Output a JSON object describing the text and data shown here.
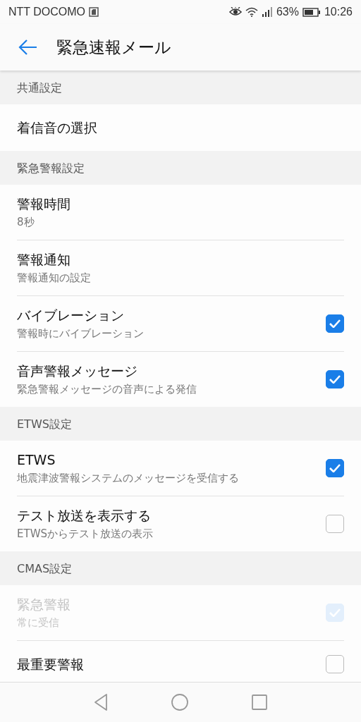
{
  "status_bar": {
    "carrier": "NTT DOCOMO",
    "battery_percent": "63%",
    "time": "10:26"
  },
  "header": {
    "title": "緊急速報メール"
  },
  "sections": [
    {
      "title": "共通設定",
      "items": [
        {
          "kind": "plain",
          "title": "着信音の選択"
        }
      ]
    },
    {
      "title": "緊急警報設定",
      "items": [
        {
          "kind": "plain",
          "title": "警報時間",
          "subtitle": "8秒"
        },
        {
          "kind": "plain",
          "title": "警報通知",
          "subtitle": "警報通知の設定"
        },
        {
          "kind": "checkbox",
          "title": "バイブレーション",
          "subtitle": "警報時にバイブレーション",
          "checked": true,
          "disabled": false
        },
        {
          "kind": "checkbox",
          "title": "音声警報メッセージ",
          "subtitle": "緊急警報メッセージの音声による発信",
          "checked": true,
          "disabled": false
        }
      ]
    },
    {
      "title": "ETWS設定",
      "items": [
        {
          "kind": "checkbox",
          "title": "ETWS",
          "subtitle": "地震津波警報システムのメッセージを受信する",
          "checked": true,
          "disabled": false
        },
        {
          "kind": "checkbox",
          "title": "テスト放送を表示する",
          "subtitle": "ETWSからテスト放送の表示",
          "checked": false,
          "disabled": false
        }
      ]
    },
    {
      "title": "CMAS設定",
      "items": [
        {
          "kind": "checkbox",
          "title": "緊急警報",
          "subtitle": "常に受信",
          "checked": true,
          "disabled": true
        },
        {
          "kind": "checkbox",
          "title": "最重要警報",
          "checked": false,
          "disabled": false
        }
      ]
    }
  ]
}
